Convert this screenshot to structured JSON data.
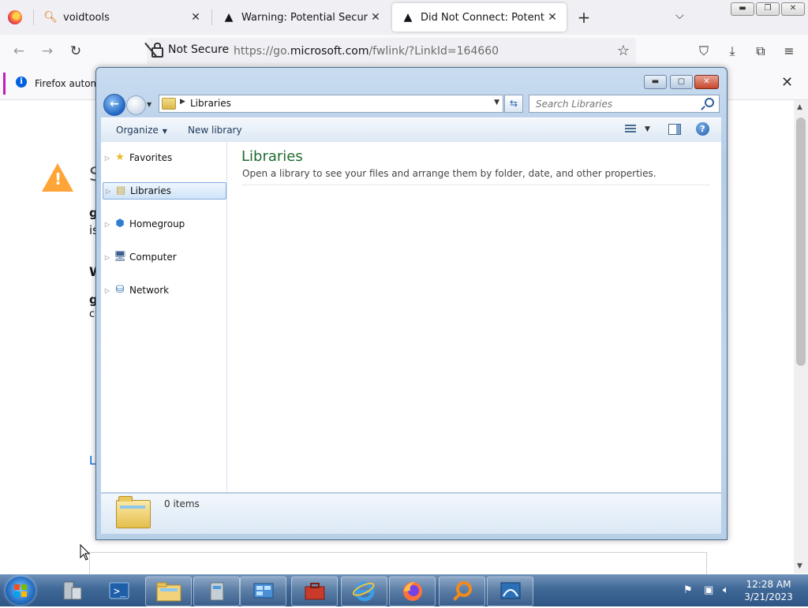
{
  "browser": {
    "tabs": [
      {
        "title": "voidtools",
        "icon": "magnifier-icon"
      },
      {
        "title": "Warning: Potential Security Risk",
        "icon": "warning-triangle-icon"
      },
      {
        "title": "Did Not Connect: Potential Security",
        "icon": "warning-triangle-icon"
      }
    ],
    "security_label": "Not Secure",
    "url_prefix": "https://go.",
    "url_domain": "microsoft.com",
    "url_suffix": "/fwlink/?LinkId=164660",
    "notification": "Firefox automa"
  },
  "page_fragments": {
    "heading_initial": "S",
    "line1": "g",
    "line2": "is",
    "line3": "W",
    "line4": "g",
    "line5": "c",
    "link": "L"
  },
  "explorer": {
    "address": "Libraries",
    "search_placeholder": "Search Libraries",
    "commands": {
      "organize": "Organize",
      "new_library": "New library"
    },
    "nav_items": [
      {
        "label": "Favorites",
        "icon": "star-icon"
      },
      {
        "label": "Libraries",
        "icon": "libraries-icon",
        "selected": true
      },
      {
        "label": "Homegroup",
        "icon": "homegroup-icon"
      },
      {
        "label": "Computer",
        "icon": "computer-icon"
      },
      {
        "label": "Network",
        "icon": "network-icon"
      }
    ],
    "title": "Libraries",
    "subtitle": "Open a library to see your files and arrange them by folder, date, and other properties.",
    "items_count": "0 items"
  },
  "taskbar": {
    "time": "12:28 AM",
    "date": "3/21/2023"
  },
  "colors": {
    "library_title": "#1e6b2e",
    "warning": "#ffa436",
    "notification_accent": "#c01dbd"
  }
}
